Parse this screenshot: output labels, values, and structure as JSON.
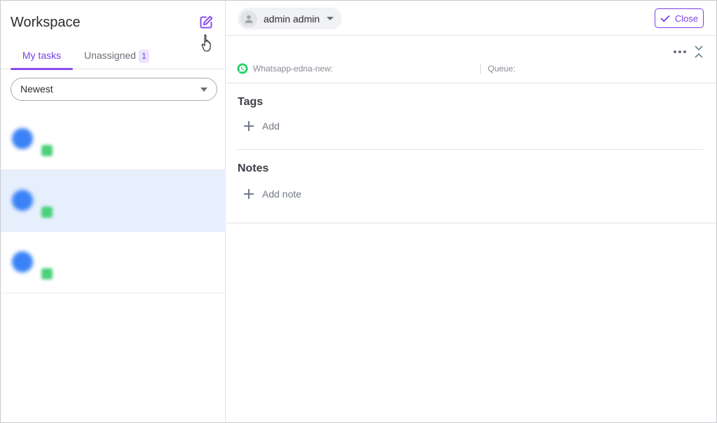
{
  "workspace": {
    "title": "Workspace",
    "tabs": {
      "my_tasks": "My tasks",
      "unassigned": "Unassigned",
      "unassigned_count": "1"
    },
    "sort": {
      "selected": "Newest"
    },
    "tasks": [
      {
        "name": "",
        "top_right": "",
        "channel": "",
        "bottom_right": "",
        "selected": false
      },
      {
        "name": "",
        "top_right": "",
        "channel": "",
        "bottom_right": "",
        "selected": true
      },
      {
        "name": "",
        "top_right": "",
        "channel": "",
        "bottom_right": "",
        "selected": false
      }
    ]
  },
  "detail": {
    "assignee": "admin admin",
    "close_label": "Close",
    "channel_name": "Whatsapp-edna-new:",
    "queue_label": "Queue:",
    "tags": {
      "title": "Tags",
      "add_label": "Add"
    },
    "notes": {
      "title": "Notes",
      "add_label": "Add note"
    }
  },
  "colors": {
    "accent": "#7a3ee6",
    "selected_row": "#e6effc",
    "avatar": "#3b82f6",
    "whatsapp": "#25d366"
  },
  "icons": {
    "new_task": "edit-square-icon",
    "cursor": "hand-pointer-icon",
    "close": "check-icon",
    "more": "more-horizontal-icon",
    "collapse": "chevrons-collapse-icon",
    "channel": "whatsapp-icon",
    "add": "plus-icon"
  }
}
